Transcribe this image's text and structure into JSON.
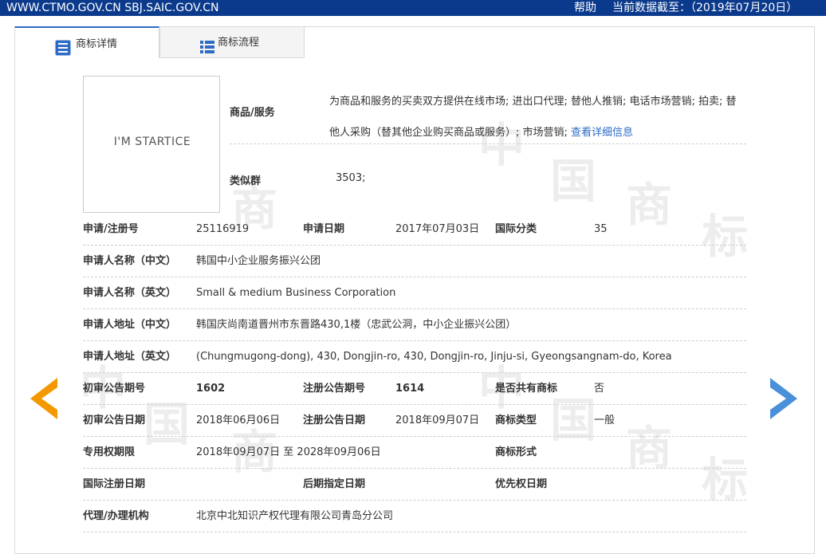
{
  "topbar": {
    "site": "WWW.CTMO.GOV.CN SBJ.SAIC.GOV.CN",
    "help": "帮助",
    "datestamp": "当前数据截至：（2019年07月20日）"
  },
  "tabs": [
    {
      "label": "商标详情",
      "icon": "document-list-icon",
      "active": true
    },
    {
      "label": "商标流程",
      "icon": "list-icon",
      "active": false
    }
  ],
  "mark_image_text": "I'M STARTICE",
  "goods": {
    "label": "商品/服务",
    "text": "为商品和服务的买卖双方提供在线市场; 进出口代理; 替他人推销; 电话市场营销; 拍卖; 替他人采购（替其他企业购买商品或服务）; 市场营销;",
    "link": "查看详细信息",
    "link_color": "#2d6bc6"
  },
  "similar_group": {
    "label": "类似群",
    "value": "3503;"
  },
  "rows": [
    {
      "cells": [
        {
          "label": "申请/注册号",
          "value": "25116919"
        },
        {
          "label": "申请日期",
          "value": "2017年07月03日"
        },
        {
          "label": "国际分类",
          "value": "35"
        }
      ]
    },
    {
      "cells": [
        {
          "label": "申请人名称（中文）",
          "value": "韩国中小企业服务振兴公团"
        }
      ]
    },
    {
      "cells": [
        {
          "label": "申请人名称（英文）",
          "value": "Small & medium Business Corporation"
        }
      ]
    },
    {
      "cells": [
        {
          "label": "申请人地址（中文）",
          "value": "韩国庆尚南道晋州市东晋路430,1楼（忠武公洞，中小企业振兴公团）"
        }
      ]
    },
    {
      "cells": [
        {
          "label": "申请人地址（英文）",
          "value": "(Chungmugong-dong), 430, Dongjin-ro, 430, Dongjin-ro, Jinju-si, Gyeongsangnam-do, Korea"
        }
      ]
    },
    {
      "cells": [
        {
          "label": "初审公告期号",
          "value": "1602"
        },
        {
          "label": "注册公告期号",
          "value": "1614"
        },
        {
          "label": "是否共有商标",
          "value": "否"
        }
      ]
    },
    {
      "cells": [
        {
          "label": "初审公告日期",
          "value": "2018年06月06日"
        },
        {
          "label": "注册公告日期",
          "value": "2018年09月07日"
        },
        {
          "label": "商标类型",
          "value": "一般"
        }
      ]
    },
    {
      "cells": [
        {
          "label": "专用权期限",
          "value": "2018年09月07日 至 2028年09月06日"
        },
        {
          "label": "商标形式",
          "value": ""
        }
      ]
    },
    {
      "cells": [
        {
          "label": "国际注册日期",
          "value": ""
        },
        {
          "label": "后期指定日期",
          "value": ""
        },
        {
          "label": "优先权日期",
          "value": ""
        }
      ]
    },
    {
      "cells": [
        {
          "label": "代理/办理机构",
          "value": "北京中北知识产权代理有限公司青岛分公司"
        }
      ]
    }
  ],
  "nav": {
    "prev_icon": "arrow-left-icon",
    "next_icon": "arrow-right-icon",
    "prev_color": "#f39800",
    "next_color": "#4a90d9"
  },
  "watermark": [
    "中",
    "国",
    "商",
    "标"
  ]
}
